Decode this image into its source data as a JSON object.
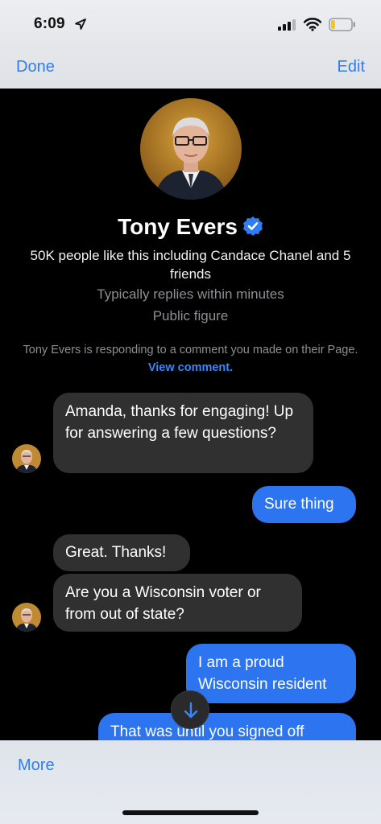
{
  "status_bar": {
    "time": "6:09",
    "icons": [
      "location-arrow-icon",
      "signal-icon",
      "wifi-icon",
      "battery-icon"
    ],
    "battery_level": 0.2,
    "battery_color": "#f5c518"
  },
  "nav": {
    "done_label": "Done",
    "edit_label": "Edit"
  },
  "profile": {
    "name": "Tony Evers",
    "verified": true,
    "likes": "50K people like this including Candace Chanel and 5 friends",
    "replies": "Typically replies within minutes",
    "category": "Public figure",
    "context_note": "Tony Evers is responding to a comment you made on their Page.",
    "view_comment_label": "View comment."
  },
  "messages": [
    {
      "direction": "incoming",
      "text": "Amanda, thanks for engaging! Up for answering a few questions?"
    },
    {
      "direction": "outgoing",
      "text": "Sure thing"
    },
    {
      "direction": "incoming",
      "text": "Great. Thanks!"
    },
    {
      "direction": "incoming",
      "text": "Are you a Wisconsin voter or from out of state?"
    },
    {
      "direction": "outgoing",
      "text": "I am a proud Wisconsin resident"
    },
    {
      "direction": "outgoing",
      "text": "That was until you signed off"
    }
  ],
  "bottom": {
    "more_label": "More"
  },
  "colors": {
    "accent": "#2f7df0",
    "outgoing_bubble": "#2d74f0",
    "incoming_bubble": "#303030",
    "link": "#3d86f7"
  }
}
